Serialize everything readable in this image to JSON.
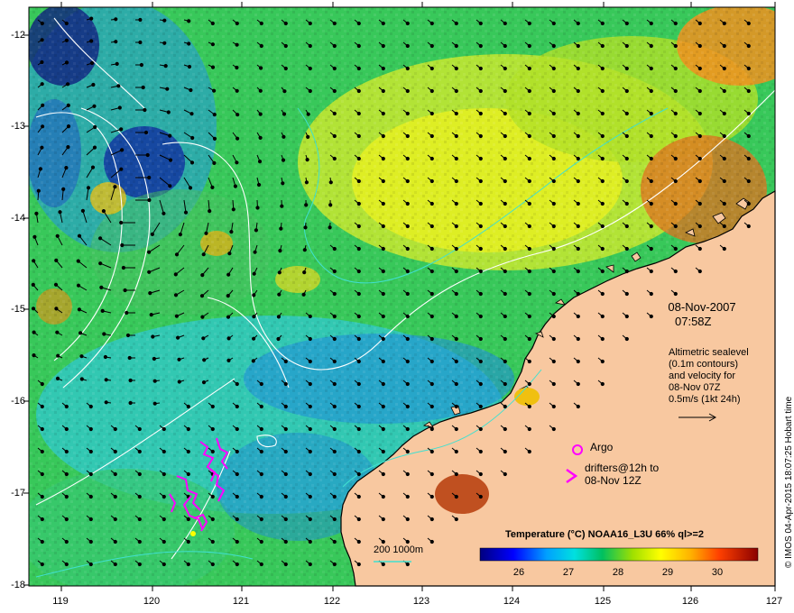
{
  "map": {
    "lat_ticks": [
      "-12",
      "-13",
      "-14",
      "-15",
      "-16",
      "-17",
      "-18"
    ],
    "lon_ticks": [
      "119",
      "120",
      "121",
      "122",
      "123",
      "124",
      "125",
      "126",
      "127"
    ],
    "lat_range": [
      -18,
      -11.85
    ],
    "lon_range": [
      118.65,
      127
    ],
    "colors": {
      "land": "#f8c8a0",
      "coast": "#000000",
      "sst_cold": "#00007f",
      "sst_mid": "#00c060",
      "sst_warm": "#8b0000",
      "contour_white": "#ffffff",
      "contour_cyan": "#40e0d0",
      "drifter": "#ff00ff"
    }
  },
  "annotations": {
    "date": "08-Nov-2007",
    "time": "07:58Z",
    "altimetry_lines": [
      "Altimetric sealevel",
      "(0.1m contours)",
      "and velocity for",
      "08-Nov 07Z",
      "0.5m/s (1kt 24h)"
    ],
    "argo_label": "Argo",
    "drifters_line1": "drifters@12h to",
    "drifters_line2": "08-Nov 12Z",
    "scale_label": "200  1000m",
    "colorbar_title": "Temperature (°C) NOAA16_L3U 66% ql>=2",
    "colorbar_ticks": [
      "26",
      "27",
      "28",
      "29",
      "30"
    ],
    "credit": "© IMOS 04-Apr-2015 18:07:25 Hobart time"
  }
}
